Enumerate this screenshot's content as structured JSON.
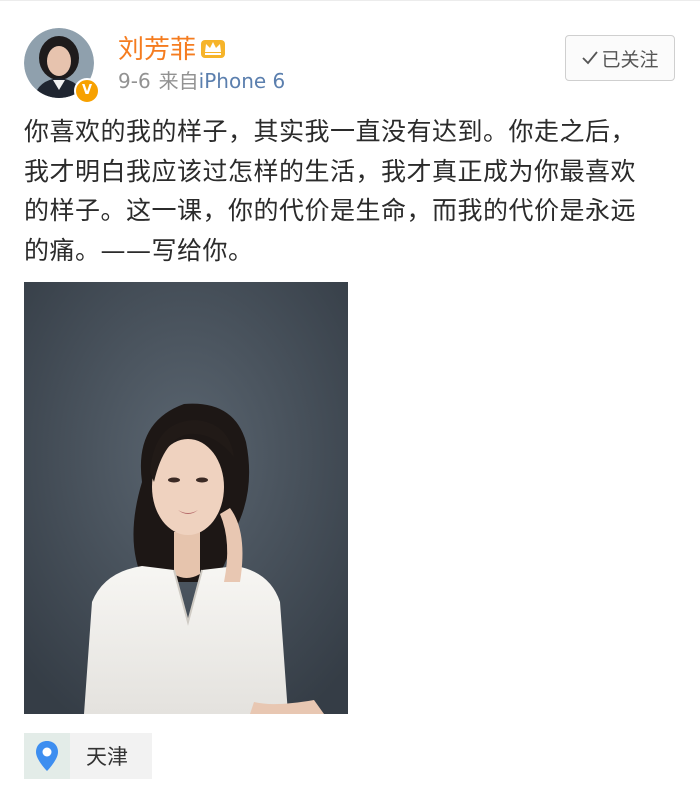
{
  "post": {
    "author": {
      "name": "刘芳菲",
      "verified_badge": "V",
      "badge_color": "#f7a100",
      "name_color": "#f57c1f",
      "icons": [
        "crown-icon",
        "verified-icon"
      ]
    },
    "time": "9-6",
    "source_prefix": "来自",
    "source_device": "iPhone 6",
    "follow_button_label": "已关注",
    "text_lines": [
      "你喜欢的我的样子，其实我一直没有达到。你走之后，",
      "我才明白我应该过怎样的生活，我才真正成为你最喜欢",
      "的样子。这一课，你的代价是生命，而我的代价是永远",
      "的痛。——写给你。"
    ],
    "location": "天津"
  }
}
